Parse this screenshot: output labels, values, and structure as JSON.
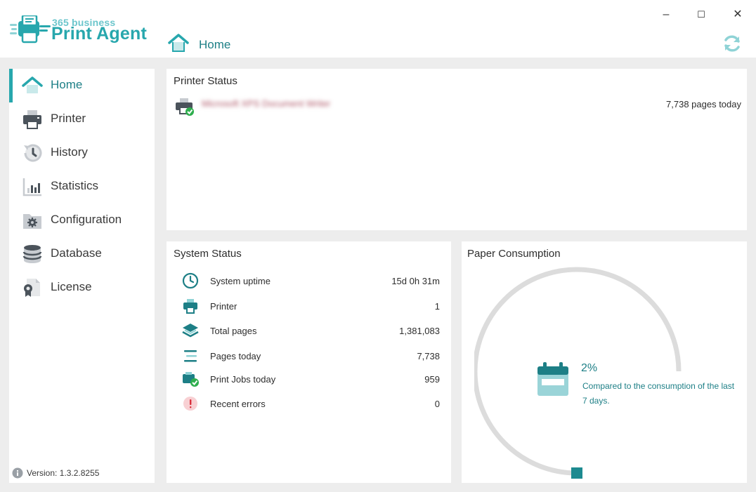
{
  "app": {
    "brand_small": "365 business",
    "brand_big": "Print Agent"
  },
  "header": {
    "title": "Home"
  },
  "window_controls": {
    "minimize": "–",
    "maximize": "☐",
    "close": "✕"
  },
  "sidebar": {
    "items": [
      {
        "label": "Home",
        "icon": "home-icon",
        "active": true
      },
      {
        "label": "Printer",
        "icon": "printer-icon",
        "active": false
      },
      {
        "label": "History",
        "icon": "history-icon",
        "active": false
      },
      {
        "label": "Statistics",
        "icon": "statistics-icon",
        "active": false
      },
      {
        "label": "Configuration",
        "icon": "configuration-icon",
        "active": false
      },
      {
        "label": "Database",
        "icon": "database-icon",
        "active": false
      },
      {
        "label": "License",
        "icon": "license-icon",
        "active": false
      }
    ],
    "version": "Version: 1.3.2.8255"
  },
  "printer_status": {
    "title": "Printer Status",
    "printer_name": "Microsoft XPS Document Writer",
    "pages_today": "7,738 pages today"
  },
  "system_status": {
    "title": "System Status",
    "rows": [
      {
        "label": "System uptime",
        "value": "15d 0h 31m",
        "icon": "clock-icon"
      },
      {
        "label": "Printer",
        "value": "1",
        "icon": "printer-icon"
      },
      {
        "label": "Total pages",
        "value": "1,381,083",
        "icon": "layers-icon"
      },
      {
        "label": "Pages today",
        "value": "7,738",
        "icon": "lines-icon"
      },
      {
        "label": "Print Jobs today",
        "value": "959",
        "icon": "print-jobs-icon"
      },
      {
        "label": "Recent errors",
        "value": "0",
        "icon": "error-icon"
      }
    ]
  },
  "paper_consumption": {
    "title": "Paper Consumption",
    "percent": "2%",
    "description": "Compared to the consumption of the last 7 days.",
    "gauge_fraction": 0.02
  },
  "colors": {
    "accent": "#27a7ad",
    "accent_dark": "#1d7f86",
    "gauge_track": "#dcdcdc",
    "background": "#ededed"
  }
}
